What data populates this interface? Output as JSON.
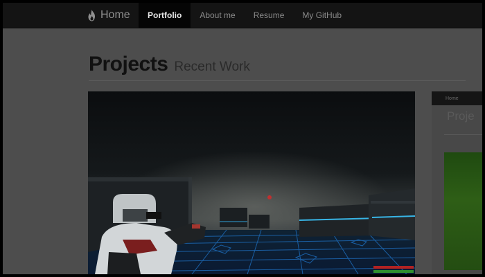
{
  "navbar": {
    "brand_label": "Home",
    "brand_icon": "flame-icon",
    "items": [
      {
        "label": "Portfolio",
        "active": true
      },
      {
        "label": "About me",
        "active": false
      },
      {
        "label": "Resume",
        "active": false
      },
      {
        "label": "My GitHub",
        "active": false
      }
    ]
  },
  "header": {
    "title": "Projects",
    "subtitle": "Recent Work"
  },
  "projects": [
    {
      "image": "game-screenshot-third-person-shooter"
    },
    {
      "image": "website-screenshot-thumbnail",
      "mini_nav": "Home",
      "mini_title": "Proje"
    }
  ],
  "colors": {
    "navbar_bg": "#141414",
    "page_bg": "#4d4d4d",
    "grid_glow": "#1e7fd6"
  }
}
